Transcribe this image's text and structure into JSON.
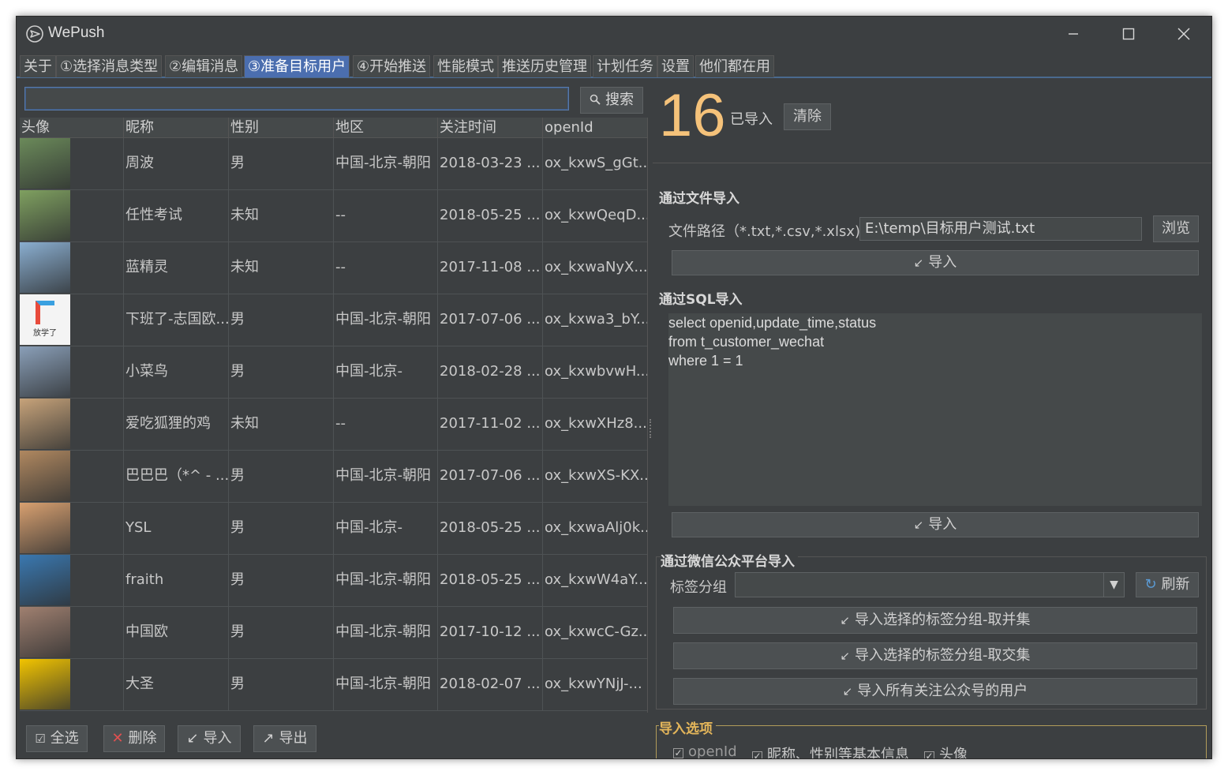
{
  "window": {
    "title": "WePush"
  },
  "tabs": [
    {
      "label": "关于"
    },
    {
      "label": "①选择消息类型"
    },
    {
      "label": "②编辑消息"
    },
    {
      "label": "③准备目标用户"
    },
    {
      "label": "④开始推送"
    },
    {
      "label": "性能模式"
    },
    {
      "label": "推送历史管理"
    },
    {
      "label": "计划任务"
    },
    {
      "label": "设置"
    },
    {
      "label": "他们都在用"
    }
  ],
  "active_tab": "③准备目标用户",
  "search": {
    "value": "",
    "button_label": "搜索"
  },
  "table": {
    "columns": [
      "头像",
      "昵称",
      "性别",
      "地区",
      "关注时间",
      "openId"
    ],
    "rows": [
      {
        "nickname": "周波",
        "gender": "男",
        "region": "中国-北京-朝阳",
        "follow_time": "2018-03-23 ...",
        "openid": "ox_kxwS_gGt..."
      },
      {
        "nickname": "任性考试",
        "gender": "未知",
        "region": "--",
        "follow_time": "2018-05-25 ...",
        "openid": "ox_kxwQeqD..."
      },
      {
        "nickname": "蓝精灵",
        "gender": "未知",
        "region": "--",
        "follow_time": "2017-11-08 ...",
        "openid": "ox_kxwaNyX..."
      },
      {
        "nickname": "下班了-志国欧...",
        "gender": "男",
        "region": "中国-北京-朝阳",
        "follow_time": "2017-07-06 ...",
        "openid": "ox_kxwa3_bY..."
      },
      {
        "nickname": "小菜鸟",
        "gender": "男",
        "region": "中国-北京-",
        "follow_time": "2018-02-28 ...",
        "openid": "ox_kxwbvwH..."
      },
      {
        "nickname": "爱吃狐狸的鸡",
        "gender": "未知",
        "region": "--",
        "follow_time": "2017-11-02 ...",
        "openid": "ox_kxwXHz8..."
      },
      {
        "nickname": "巴巴巴（*^ - ...",
        "gender": "男",
        "region": "中国-北京-朝阳",
        "follow_time": "2017-07-06 ...",
        "openid": "ox_kxwXS-KX..."
      },
      {
        "nickname": "YSL",
        "gender": "男",
        "region": "中国-北京-",
        "follow_time": "2018-05-25 ...",
        "openid": "ox_kxwaAlj0k..."
      },
      {
        "nickname": "fraith",
        "gender": "男",
        "region": "中国-北京-朝阳",
        "follow_time": "2018-05-25 ...",
        "openid": "ox_kxwW4aY..."
      },
      {
        "nickname": "中国欧",
        "gender": "男",
        "region": "中国-北京-朝阳",
        "follow_time": "2017-10-12 ...",
        "openid": "ox_kxwcC-Gz..."
      },
      {
        "nickname": "大圣",
        "gender": "男",
        "region": "中国-北京-朝阳",
        "follow_time": "2018-02-07 ...",
        "openid": "ox_kxwYNjJ-..."
      }
    ],
    "avatar_colors": [
      "#6b8a5a",
      "#7fa060",
      "#8aaed0",
      "#f0f0f0",
      "#8a9fb8",
      "#c7a37a",
      "#b08860",
      "#d8a070",
      "#3a78b0",
      "#a08070",
      "#f2c400"
    ],
    "avatar_text_4": "放学了"
  },
  "bottom_buttons": {
    "select_all": "全选",
    "delete": "删除",
    "import": "导入",
    "export": "导出"
  },
  "right": {
    "count": "16",
    "count_label": "已导入",
    "clear_label": "清除",
    "file_import": {
      "title": "通过文件导入",
      "path_label": "文件路径（*.txt,*.csv,*.xlsx)",
      "path_value": "E:\\temp\\目标用户测试.txt",
      "browse_label": "浏览",
      "import_label": "导入"
    },
    "sql_import": {
      "title": "通过SQL导入",
      "lines": [
        "select openid,update_time,status",
        "from t_customer_wechat",
        "where 1 = 1"
      ],
      "import_label": "导入"
    },
    "mp_import": {
      "title": "通过微信公众平台导入",
      "tag_label": "标签分组",
      "tag_value": "",
      "refresh_label": "刷新",
      "btn_union": "导入选择的标签分组-取并集",
      "btn_intersect": "导入选择的标签分组-取交集",
      "btn_all": "导入所有关注公众号的用户"
    },
    "options": {
      "title": "导入选项",
      "openid": "openId",
      "basic_info": "昵称、性别等基本信息",
      "avatar": "头像"
    }
  },
  "colors": {
    "accent": "#4b6eaf",
    "count": "#f5c27a",
    "background": "#3c3f41",
    "delete_x": "#e05050"
  }
}
